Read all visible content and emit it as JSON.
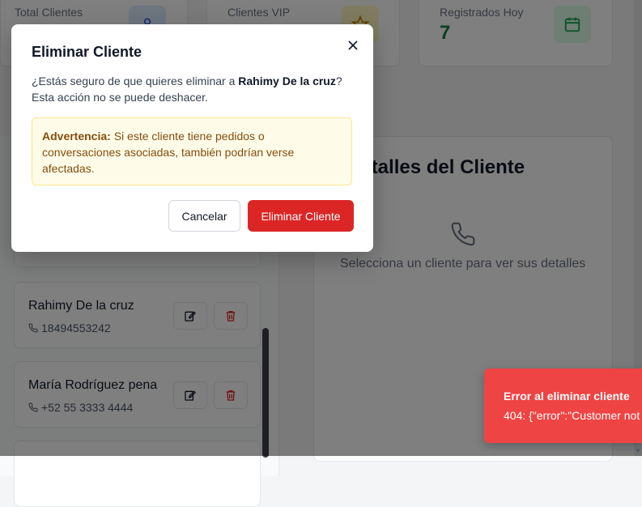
{
  "stats": [
    {
      "label": "Total Clientes",
      "value": "",
      "icon": "user-icon",
      "color": "#dbeafe"
    },
    {
      "label": "Clientes VIP",
      "value": "",
      "icon": "star-icon",
      "color": "#fef9c3"
    },
    {
      "label": "Registrados Hoy",
      "value": "7",
      "icon": "calendar-icon",
      "color": "#dcfce7"
    }
  ],
  "customers": [
    {
      "name": "Rahimy De la cruz",
      "phone": "18494553242"
    },
    {
      "name": "María Rodríguez pena",
      "phone": "+52 55 3333 4444"
    }
  ],
  "details": {
    "title": "Detalles del Cliente",
    "empty_message": "Selecciona un cliente para ver sus detalles"
  },
  "modal": {
    "title": "Eliminar Cliente",
    "message_prefix": "¿Estás seguro de que quieres eliminar a ",
    "customer_name": "Rahimy De la cruz",
    "message_suffix": "? Esta acción no se puede deshacer.",
    "warning_label": "Advertencia:",
    "warning_text": " Si este cliente tiene pedidos o conversaciones asociadas, también podrían verse afectadas.",
    "cancel_label": "Cancelar",
    "confirm_label": "Eliminar Cliente",
    "close_icon": "close-icon"
  },
  "toast": {
    "title": "Error al eliminar cliente",
    "body": "404: {\"error\":\"Customer not"
  },
  "colors": {
    "danger": "#dc2626",
    "toast": "#ef4444",
    "success": "#15803d",
    "warning_bg": "#fefce8"
  }
}
